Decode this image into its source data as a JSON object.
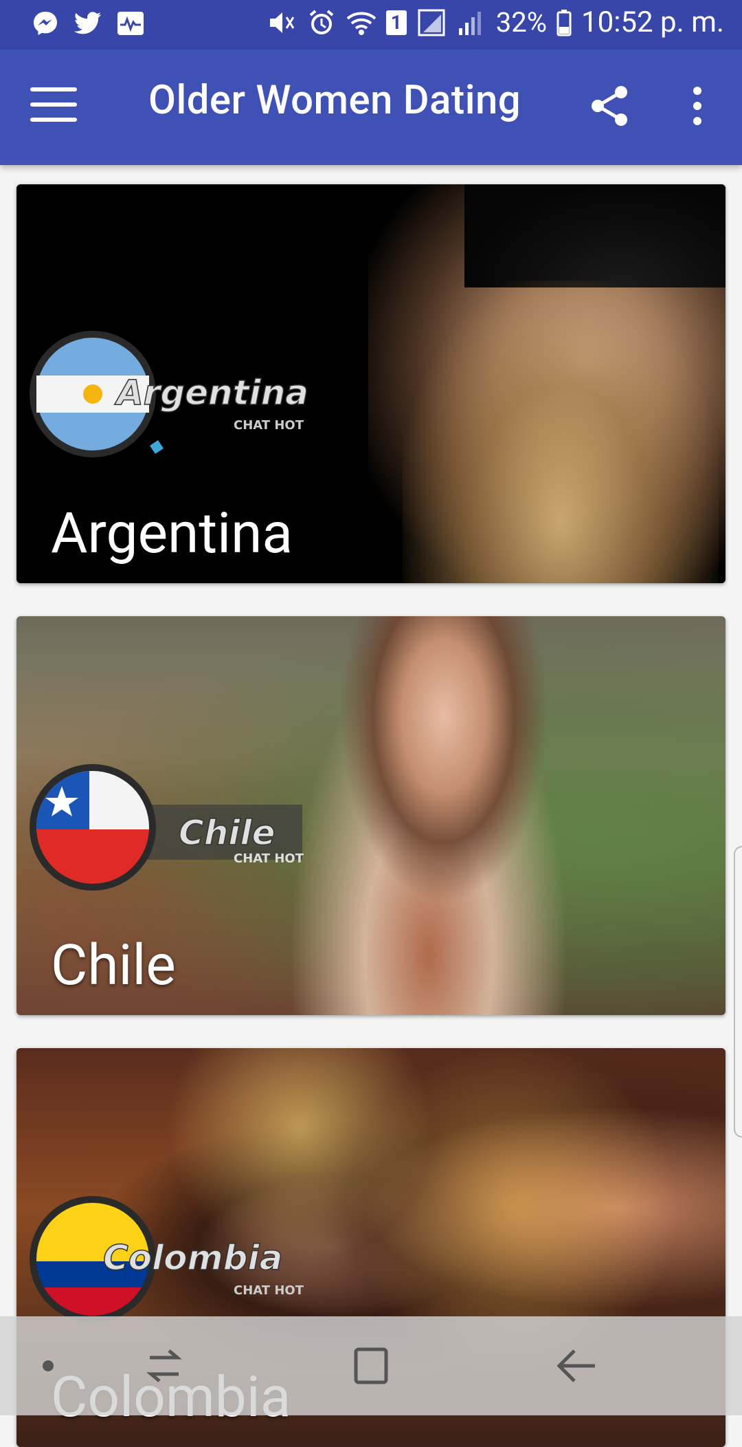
{
  "status_bar": {
    "battery": "32%",
    "time": "10:52 p. m.",
    "sim_slot": "1"
  },
  "app_bar": {
    "title": "Older Women Dating"
  },
  "cards": [
    {
      "label": "Argentina",
      "logo_text": "Argentina",
      "logo_sub": "CHAT HOT"
    },
    {
      "label": "Chile",
      "logo_text": "Chile",
      "logo_sub": "CHAT HOT"
    },
    {
      "label": "Colombia",
      "logo_text": "Colombia",
      "logo_sub": "CHAT HOT"
    }
  ],
  "colors": {
    "status_bar": "#3746a8",
    "app_bar": "#3f51b5",
    "background": "#f4f4f4"
  }
}
